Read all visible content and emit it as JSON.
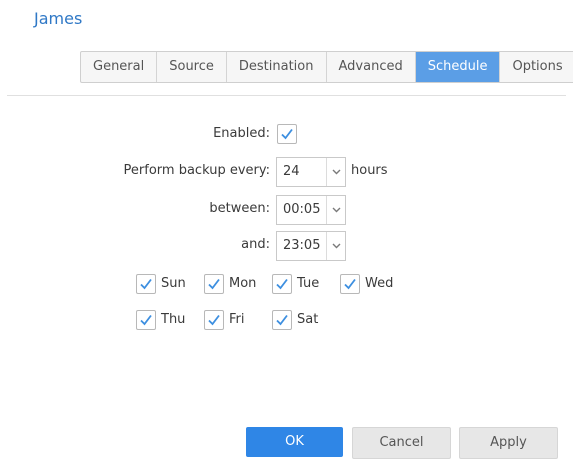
{
  "window": {
    "title": "James"
  },
  "tabs": [
    {
      "label": "General",
      "active": false
    },
    {
      "label": "Source",
      "active": false
    },
    {
      "label": "Destination",
      "active": false
    },
    {
      "label": "Advanced",
      "active": false
    },
    {
      "label": "Schedule",
      "active": true
    },
    {
      "label": "Options",
      "active": false
    }
  ],
  "schedule": {
    "enabled_label": "Enabled:",
    "enabled": true,
    "every_label": "Perform backup every:",
    "every_value": "24",
    "every_unit": "hours",
    "between_label": "between:",
    "between_value": "00:05",
    "and_label": "and:",
    "and_value": "23:05",
    "days": [
      {
        "label": "Sun",
        "checked": true
      },
      {
        "label": "Mon",
        "checked": true
      },
      {
        "label": "Tue",
        "checked": true
      },
      {
        "label": "Wed",
        "checked": true
      },
      {
        "label": "Thu",
        "checked": true
      },
      {
        "label": "Fri",
        "checked": true
      },
      {
        "label": "Sat",
        "checked": true
      }
    ]
  },
  "buttons": {
    "ok": "OK",
    "cancel": "Cancel",
    "apply": "Apply"
  },
  "colors": {
    "accent": "#2f86e6",
    "tab_active": "#5b9ee6",
    "title": "#2f78c6",
    "check": "#3d8fe0"
  },
  "icons": {
    "checkbox": "checkmark-icon",
    "dropdown": "chevron-down-icon"
  }
}
